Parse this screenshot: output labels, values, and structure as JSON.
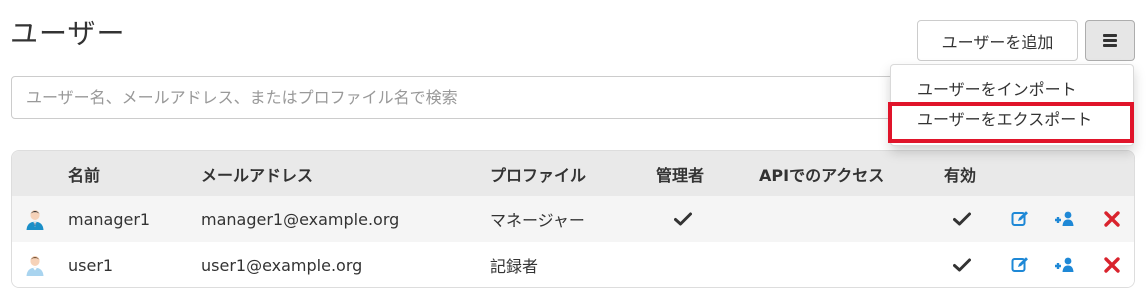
{
  "header": {
    "title": "ユーザー",
    "add_user_label": "ユーザーを追加",
    "menu_icon": "bars-icon"
  },
  "search": {
    "placeholder": "ユーザー名、メールアドレス、またはプロファイル名で検索",
    "value": ""
  },
  "dropdown": {
    "items": [
      {
        "label": "ユーザーをインポート"
      },
      {
        "label": "ユーザーをエクスポート"
      }
    ],
    "highlight_color": "#e0142a"
  },
  "table": {
    "columns": [
      "名前",
      "メールアドレス",
      "プロファイル",
      "管理者",
      "APIでのアクセス",
      "有効"
    ],
    "rows": [
      {
        "avatar": "manager-avatar-icon",
        "name": "manager1",
        "email": "manager1@example.org",
        "profile": "マネージャー",
        "admin": true,
        "api_access": false,
        "enabled": true
      },
      {
        "avatar": "user-avatar-icon",
        "name": "user1",
        "email": "user1@example.org",
        "profile": "記録者",
        "admin": false,
        "api_access": false,
        "enabled": true
      }
    ]
  },
  "colors": {
    "action_blue": "#1e88d6",
    "delete_red": "#d9232d",
    "header_bg": "#e9e9e9"
  }
}
